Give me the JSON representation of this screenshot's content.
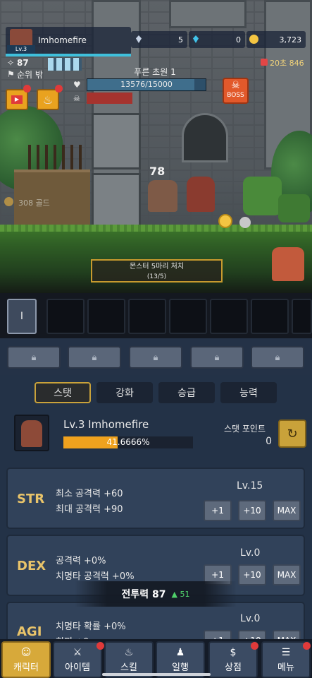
{
  "hud": {
    "level_badge": "Lv.3",
    "player_name": "Imhomefire",
    "power": "87",
    "rank": "순위 밖",
    "currency": {
      "crystal_a": "5",
      "crystal_b": "0",
      "gold": "3,723",
      "timer": "20초 846"
    }
  },
  "stage": {
    "name": "푸른 초원 1",
    "hp_text": "13576/15000",
    "hp_fraction": 0.905,
    "boss_label": "BOSS",
    "damage_number": "78",
    "gold_drop": "308 골드"
  },
  "quest": {
    "title": "몬스터 5마리 처치",
    "progress": "(13/5)"
  },
  "skill_slot_label": "I",
  "tabs": [
    "스탯",
    "강화",
    "승급",
    "능력"
  ],
  "profile": {
    "level_name": "Lv.3 Imhomefire",
    "exp_text": "41.6666%",
    "exp_fraction": 0.4167,
    "stat_point_label": "스탯 포인트",
    "stat_point_value": "0"
  },
  "stats": [
    {
      "name": "STR",
      "line1": "최소 공격력 +60",
      "line2": "최대 공격력 +90",
      "level": "Lv.15"
    },
    {
      "name": "DEX",
      "line1": "공격력 +0%",
      "line2": "치명타 공격력 +0%",
      "level": "Lv.0"
    },
    {
      "name": "AGI",
      "line1": "치명타 확률 +0%",
      "line2": "회피 +0",
      "level": "Lv.0"
    }
  ],
  "buttons": {
    "plus1": "+1",
    "plus10": "+10",
    "max": "MAX"
  },
  "combat_power": {
    "label": "전투력 87",
    "delta": "▲ 51"
  },
  "nav": [
    {
      "label": "캐릭터",
      "icon": "character-icon"
    },
    {
      "label": "아이템",
      "icon": "sword-icon"
    },
    {
      "label": "스킬",
      "icon": "flame-icon"
    },
    {
      "label": "일행",
      "icon": "party-icon"
    },
    {
      "label": "상점",
      "icon": "money-bag-icon"
    },
    {
      "label": "메뉴",
      "icon": "hamburger-icon"
    }
  ],
  "colors": {
    "accent": "#c9a23a",
    "exp": "#f0a21e",
    "hp": "#2d4f69",
    "boss": "#e2592b"
  }
}
